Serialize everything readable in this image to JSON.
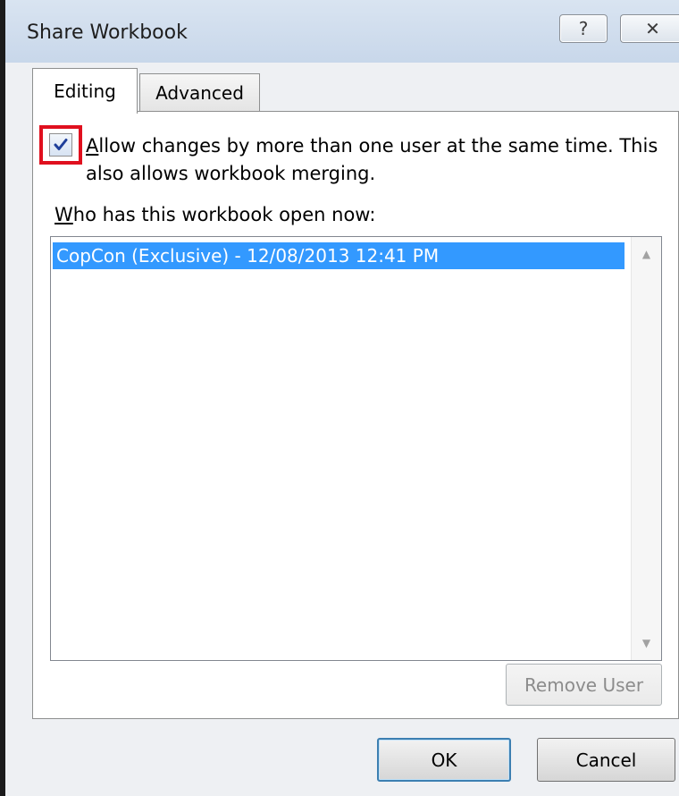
{
  "window": {
    "title": "Share Workbook",
    "help_glyph": "?",
    "close_glyph": "✕"
  },
  "tabs": [
    {
      "label": "Editing",
      "selected": true
    },
    {
      "label": "Advanced",
      "selected": false
    }
  ],
  "editing": {
    "allow_checkbox": {
      "checked": true,
      "mnemonic": "A",
      "label_rest": "llow changes by more than one user at the same time.  This",
      "label_line2": "also allows workbook merging."
    },
    "who_label_mnemonic": "W",
    "who_label_rest": "ho has this workbook open now:",
    "users": [
      {
        "text": "CopCon (Exclusive) - 12/08/2013 12:41 PM",
        "selected": true
      }
    ],
    "scroll_up_glyph": "▲",
    "scroll_down_glyph": "▼",
    "remove_user_label": "Remove User"
  },
  "footer": {
    "ok_label": "OK",
    "cancel_label": "Cancel"
  },
  "colors": {
    "highlight_box": "#e0101e",
    "selection": "#3399ff",
    "checkmark": "#1f3f9a"
  },
  "icons": {
    "help": "help-icon",
    "close": "close-icon",
    "checkmark": "checkmark-icon",
    "scroll_up": "scroll-up-arrow-icon",
    "scroll_down": "scroll-down-arrow-icon"
  }
}
